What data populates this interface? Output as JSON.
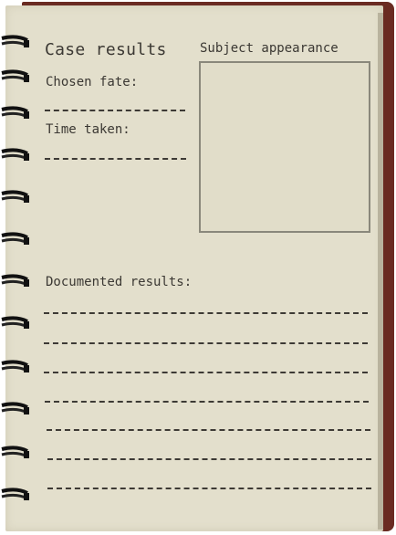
{
  "report": {
    "title": "Case results",
    "chosen_fate_label": "Chosen fate:",
    "chosen_fate_value": "",
    "time_taken_label": "Time taken:",
    "time_taken_value": "",
    "appearance_label": "Subject appearance",
    "documented_label": "Documented results:",
    "documented_lines": [
      "",
      "",
      "",
      "",
      "",
      "",
      ""
    ]
  },
  "colors": {
    "page": "#e3dfcc",
    "cover": "#6a2b22",
    "ink": "#3b3833",
    "box_border": "#8a887b"
  },
  "icons": {
    "binding": "spiral-ring-icon"
  }
}
